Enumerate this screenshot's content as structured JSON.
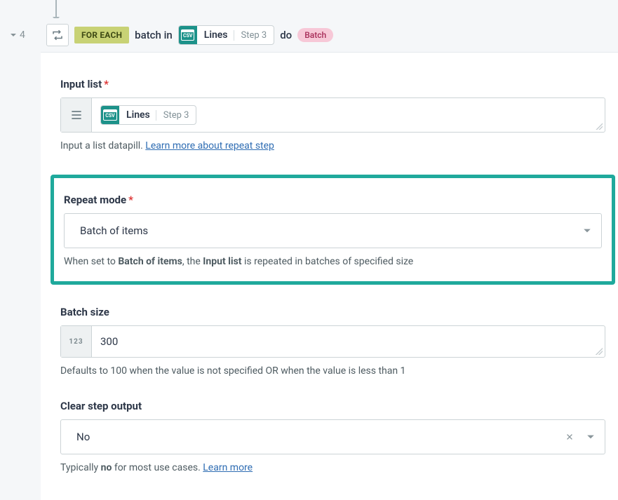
{
  "step_number": "4",
  "header": {
    "foreach": "FOR EACH",
    "var": "batch in",
    "pill_label": "Lines",
    "pill_sub": "Step 3",
    "do": "do",
    "batch_tag": "Batch"
  },
  "fields": {
    "input_list": {
      "label": "Input list",
      "pill_label": "Lines",
      "pill_sub": "Step 3",
      "helper_pre": "Input a list datapill. ",
      "helper_link": "Learn more about repeat step"
    },
    "repeat_mode": {
      "label": "Repeat mode",
      "value": "Batch of items",
      "helper_p1": "When set to ",
      "helper_b1": "Batch of items",
      "helper_p2": ", the ",
      "helper_b2": "Input list",
      "helper_p3": " is repeated in batches of specified size"
    },
    "batch_size": {
      "label": "Batch size",
      "prefix": "123",
      "value": "300",
      "helper": "Defaults to 100 when the value is not specified OR when the value is less than 1"
    },
    "clear_output": {
      "label": "Clear step output",
      "value": "No",
      "helper_p1": "Typically ",
      "helper_b1": "no",
      "helper_p2": " for most use cases. ",
      "helper_link": "Learn more"
    }
  }
}
